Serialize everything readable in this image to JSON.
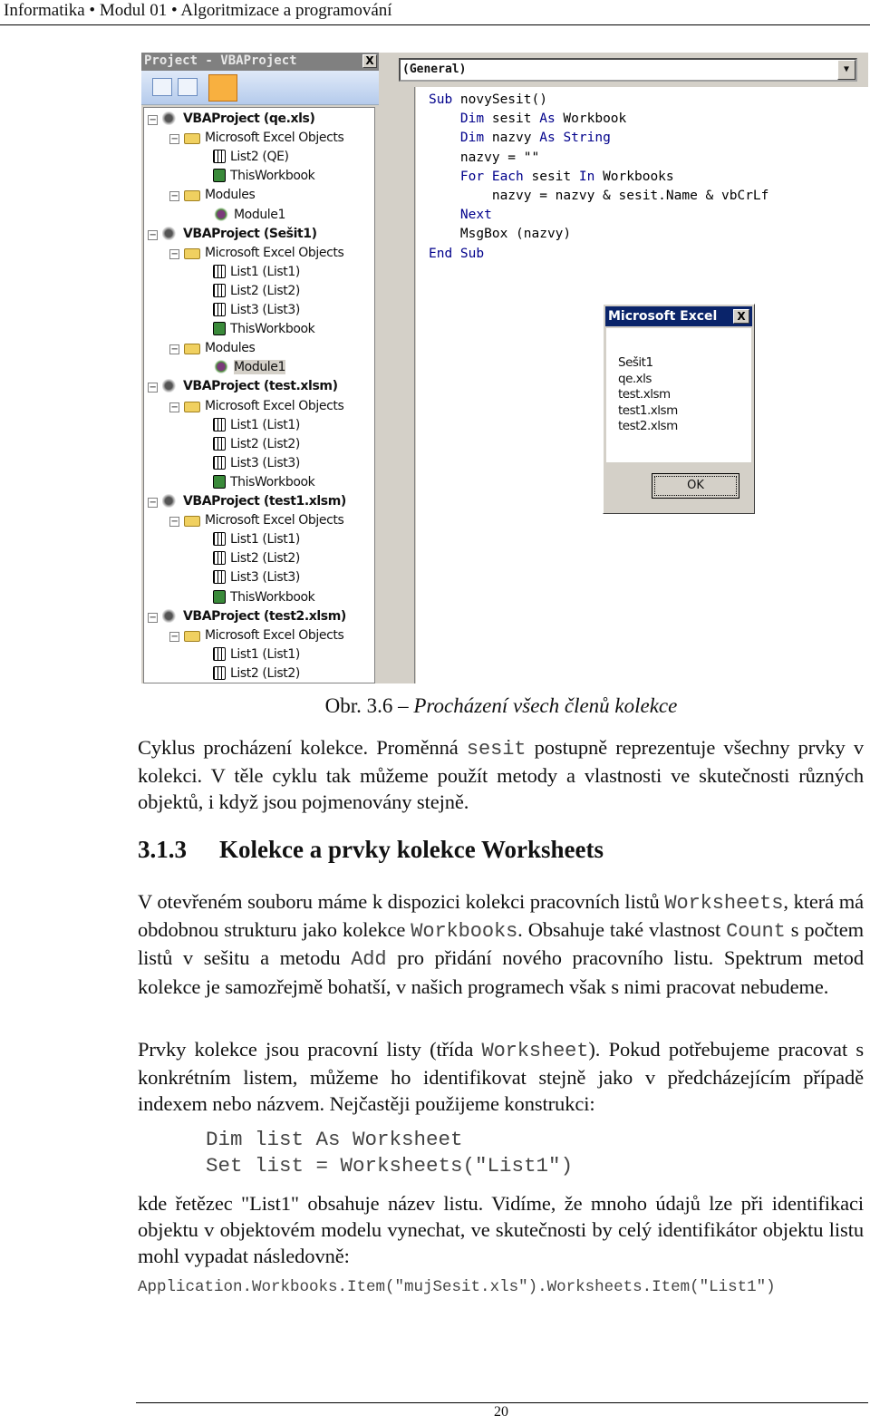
{
  "header": {
    "text": "Informatika • Modul 01 • Algoritmizace a programování"
  },
  "project": {
    "title": "Project - VBAProject",
    "close": "X",
    "tree": [
      {
        "level": 0,
        "icon": "project",
        "text": "VBAProject (qe.xls)"
      },
      {
        "level": 1,
        "icon": "folder",
        "text": "Microsoft Excel Objects"
      },
      {
        "level": 2,
        "icon": "sheet",
        "text": "List2 (QE)"
      },
      {
        "level": 2,
        "icon": "workbook",
        "text": "ThisWorkbook"
      },
      {
        "level": 1,
        "icon": "folder",
        "text": "Modules"
      },
      {
        "level": 2,
        "icon": "module",
        "text": "Module1"
      },
      {
        "level": 0,
        "icon": "project",
        "text": "VBAProject (Sešit1)"
      },
      {
        "level": 1,
        "icon": "folder",
        "text": "Microsoft Excel Objects"
      },
      {
        "level": 2,
        "icon": "sheet",
        "text": "List1 (List1)"
      },
      {
        "level": 2,
        "icon": "sheet",
        "text": "List2 (List2)"
      },
      {
        "level": 2,
        "icon": "sheet",
        "text": "List3 (List3)"
      },
      {
        "level": 2,
        "icon": "workbook",
        "text": "ThisWorkbook"
      },
      {
        "level": 1,
        "icon": "folder",
        "text": "Modules"
      },
      {
        "level": 2,
        "icon": "module",
        "text": "Module1",
        "selected": true
      },
      {
        "level": 0,
        "icon": "project",
        "text": "VBAProject (test.xlsm)"
      },
      {
        "level": 1,
        "icon": "folder",
        "text": "Microsoft Excel Objects"
      },
      {
        "level": 2,
        "icon": "sheet",
        "text": "List1 (List1)"
      },
      {
        "level": 2,
        "icon": "sheet",
        "text": "List2 (List2)"
      },
      {
        "level": 2,
        "icon": "sheet",
        "text": "List3 (List3)"
      },
      {
        "level": 2,
        "icon": "workbook",
        "text": "ThisWorkbook"
      },
      {
        "level": 0,
        "icon": "project",
        "text": "VBAProject (test1.xlsm)"
      },
      {
        "level": 1,
        "icon": "folder",
        "text": "Microsoft Excel Objects"
      },
      {
        "level": 2,
        "icon": "sheet",
        "text": "List1 (List1)"
      },
      {
        "level": 2,
        "icon": "sheet",
        "text": "List2 (List2)"
      },
      {
        "level": 2,
        "icon": "sheet",
        "text": "List3 (List3)"
      },
      {
        "level": 2,
        "icon": "workbook",
        "text": "ThisWorkbook"
      },
      {
        "level": 0,
        "icon": "project",
        "text": "VBAProject (test2.xlsm)"
      },
      {
        "level": 1,
        "icon": "folder",
        "text": "Microsoft Excel Objects"
      },
      {
        "level": 2,
        "icon": "sheet",
        "text": "List1 (List1)"
      },
      {
        "level": 2,
        "icon": "sheet",
        "text": "List2 (List2)"
      }
    ]
  },
  "editor": {
    "combo": "(General)",
    "lines": [
      [
        [
          "Sub",
          "k"
        ],
        [
          " novySesit()",
          ""
        ]
      ],
      [
        [
          "    ",
          ""
        ],
        [
          "Dim",
          "k"
        ],
        [
          " sesit ",
          ""
        ],
        [
          "As",
          "k"
        ],
        [
          " Workbook",
          ""
        ]
      ],
      [
        [
          "    ",
          ""
        ],
        [
          "Dim",
          "k"
        ],
        [
          " nazvy ",
          ""
        ],
        [
          "As",
          "k"
        ],
        [
          " ",
          ""
        ],
        [
          "String",
          "k"
        ]
      ],
      [
        [
          "    nazvy = \"\"",
          ""
        ]
      ],
      [
        [
          "    ",
          ""
        ],
        [
          "For Each",
          "k"
        ],
        [
          " sesit ",
          ""
        ],
        [
          "In",
          "k"
        ],
        [
          " Workbooks",
          ""
        ]
      ],
      [
        [
          "        nazvy = nazvy & sesit.Name & vbCrLf",
          ""
        ]
      ],
      [
        [
          "    ",
          ""
        ],
        [
          "Next",
          "k"
        ]
      ],
      [
        [
          "    MsgBox (nazvy)",
          ""
        ]
      ],
      [
        [
          "End Sub",
          "k"
        ]
      ]
    ]
  },
  "msgbox": {
    "title": "Microsoft Excel",
    "close": "X",
    "lines": [
      "Sešit1",
      "qe.xls",
      "test.xlsm",
      "test1.xlsm",
      "test2.xlsm"
    ],
    "ok": "OK"
  },
  "caption": {
    "label": "Obr. 3.6 – ",
    "title": "Procházení všech členů kolekce"
  },
  "p1": [
    "Cyklus procházení kolekce. Proměnná ",
    "sesit",
    " postupně reprezentuje všechny prvky v kolekci. V těle cyklu tak můžeme použít metody a vlastnosti ve skutečnosti různých objektů, i když jsou pojmenovány stejně."
  ],
  "heading": {
    "number": "3.1.3",
    "title": "Kolekce a prvky kolekce Worksheets"
  },
  "p2": [
    "V otevřeném souboru máme k dispozici kolekci pracovních listů ",
    "Worksheets",
    ", která má obdobnou strukturu jako kolekce ",
    "Workbooks",
    ". Obsahuje také vlastnost ",
    "Count",
    " s počtem listů v sešitu a metodu ",
    "Add",
    " pro přidání nového pracovního listu. Spektrum metod kolekce je samozřejmě bohatší, v našich programech však s nimi pracovat nebudeme."
  ],
  "p3": [
    "Prvky kolekce jsou pracovní listy (třída ",
    "Worksheet",
    "). Pokud potřebujeme pracovat s konkrétním listem, můžeme ho identifikovat stejně jako v předcházejícím případě indexem nebo názvem. Nejčastěji použijeme konstrukci:"
  ],
  "code_block": [
    "Dim list As Worksheet",
    "Set list = Worksheets(\"List1\")"
  ],
  "p4": [
    "kde řetězec \"List1\" obsahuje název listu. Vidíme, že mnoho údajů lze při identifikaci objektu v objektovém modelu vynechat, ve skutečnosti by celý identifikátor objektu listu mohl vypadat následovně:"
  ],
  "code_line": "Application.Workbooks.Item(\"mujSesit.xls\").Worksheets.Item(\"List1\")",
  "page_number": "20"
}
